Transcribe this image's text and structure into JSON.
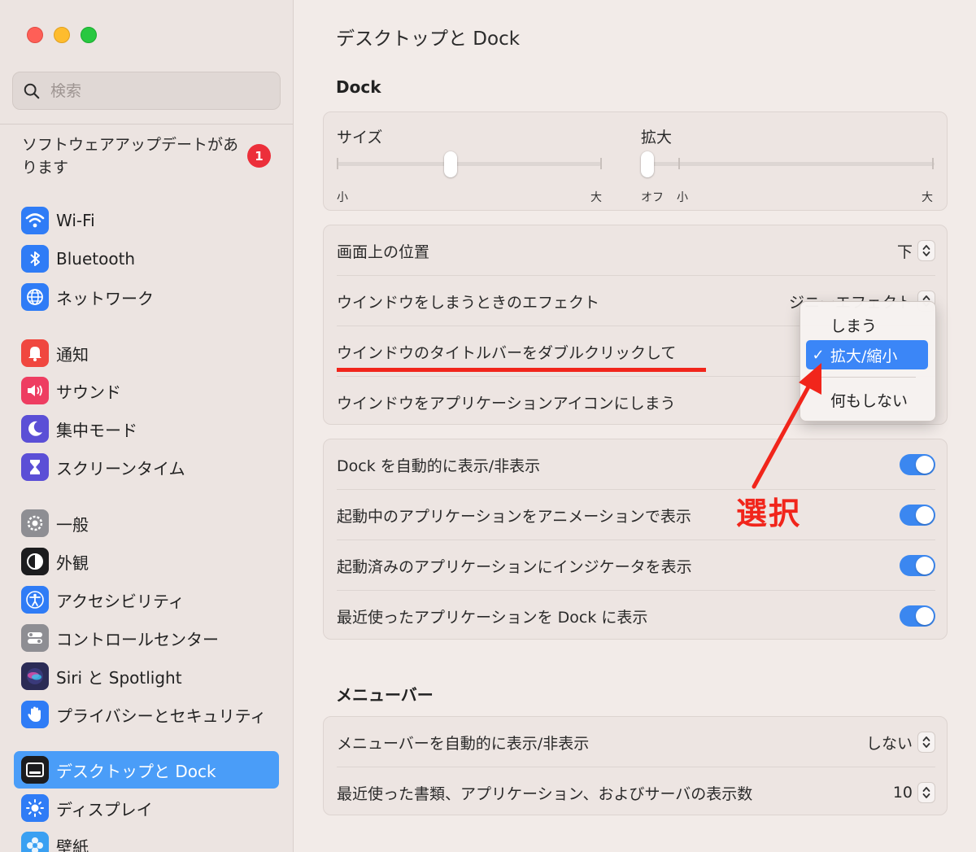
{
  "window_controls": [
    "close",
    "minimize",
    "zoom"
  ],
  "sidebar": {
    "search_placeholder": "検索",
    "update": {
      "text": "ソフトウェアアップデートがあります",
      "badge": "1"
    },
    "items": [
      {
        "label": "Wi-Fi",
        "icon": "wifi-icon",
        "color": "#2f7cf6"
      },
      {
        "label": "Bluetooth",
        "icon": "bluetooth-icon",
        "color": "#2f7cf6"
      },
      {
        "label": "ネットワーク",
        "icon": "globe-icon",
        "color": "#2f7cf6"
      },
      {
        "label": "通知",
        "icon": "bell-icon",
        "color": "#f0473f"
      },
      {
        "label": "サウンド",
        "icon": "speaker-icon",
        "color": "#ee3d61"
      },
      {
        "label": "集中モード",
        "icon": "moon-icon",
        "color": "#5b4fd6"
      },
      {
        "label": "スクリーンタイム",
        "icon": "hourglass-icon",
        "color": "#5b4fd6"
      },
      {
        "label": "一般",
        "icon": "gear-icon",
        "color": "#8e8e93"
      },
      {
        "label": "外観",
        "icon": "appearance-icon",
        "color": "#1c1c1e"
      },
      {
        "label": "アクセシビリティ",
        "icon": "accessibility-icon",
        "color": "#2f7cf6"
      },
      {
        "label": "コントロールセンター",
        "icon": "control-center-icon",
        "color": "#8e8e93"
      },
      {
        "label": "Siri と Spotlight",
        "icon": "siri-icon",
        "color": "#2b2b55"
      },
      {
        "label": "プライバシーとセキュリティ",
        "icon": "hand-icon",
        "color": "#2f7cf6"
      },
      {
        "label": "デスクトップと Dock",
        "icon": "dock-icon",
        "color": "#1c1c1e",
        "active": true
      },
      {
        "label": "ディスプレイ",
        "icon": "sun-icon",
        "color": "#2f7cf6"
      },
      {
        "label": "壁紙",
        "icon": "flower-icon",
        "color": "#3aa0f2"
      }
    ]
  },
  "main": {
    "title": "デスクトップと Dock",
    "dock_section": "Dock",
    "size_slider": {
      "title": "サイズ",
      "min_label": "小",
      "max_label": "大",
      "value": 0.43
    },
    "magnify_slider": {
      "title": "拡大",
      "off_label": "オフ",
      "min_label": "小",
      "max_label": "大",
      "value": 0.0
    },
    "settings": [
      {
        "label": "画面上の位置",
        "value": "下"
      },
      {
        "label": "ウインドウをしまうときのエフェクト",
        "value": "ジニーエフェクト"
      },
      {
        "label": "ウインドウのタイトルバーをダブルクリックして",
        "value": ""
      },
      {
        "label": "ウインドウをアプリケーションアイコンにしまう",
        "value": ""
      }
    ],
    "toggles": [
      {
        "label": "Dock を自動的に表示/非表示",
        "on": true
      },
      {
        "label": "起動中のアプリケーションをアニメーションで表示",
        "on": true
      },
      {
        "label": "起動済みのアプリケーションにインジケータを表示",
        "on": true
      },
      {
        "label": "最近使ったアプリケーションを Dock に表示",
        "on": true
      }
    ],
    "menubar_section": "メニューバー",
    "menubar_settings": [
      {
        "label": "メニューバーを自動的に表示/非表示",
        "value": "しない"
      },
      {
        "label": "最近使った書類、アプリケーション、およびサーバの表示数",
        "value": "10"
      }
    ],
    "popup": {
      "items": [
        "しまう",
        "拡大/縮小",
        "何もしない"
      ],
      "selected": "拡大/縮小",
      "check": "✓"
    },
    "annotation": {
      "label": "選択",
      "color": "#f1251b"
    }
  }
}
